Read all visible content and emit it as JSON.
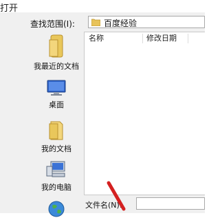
{
  "window": {
    "title_fragment": "打开"
  },
  "lookin": {
    "label": "查找范围(I):",
    "value": "百度经验"
  },
  "places": [
    {
      "label": "我最近的文档",
      "icon": "recent-documents-icon"
    },
    {
      "label": "桌面",
      "icon": "desktop-icon"
    },
    {
      "label": "我的文档",
      "icon": "my-documents-icon"
    },
    {
      "label": "我的电脑",
      "icon": "my-computer-icon"
    },
    {
      "label": "",
      "icon": "network-globe-icon"
    }
  ],
  "filelist": {
    "columns": [
      "名称",
      "修改日期"
    ]
  },
  "filename": {
    "label": "文件名(N):",
    "value": ""
  },
  "colors": {
    "dialog_bg": "#f0f0f0",
    "folder": "#e8c35a",
    "arrow": "#d42020"
  }
}
